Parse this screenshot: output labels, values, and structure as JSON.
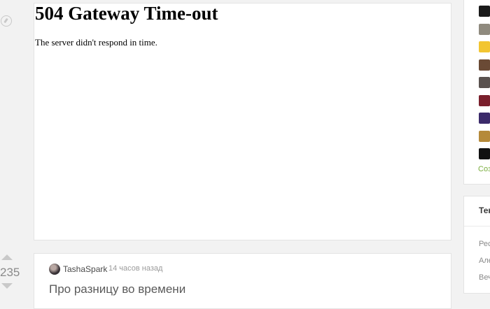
{
  "error_page": {
    "title": "504 Gateway Time-out",
    "message": "The server didn't respond in time."
  },
  "post": {
    "votes": "235",
    "author": "TashaSpark",
    "time": "14 часов назад",
    "title": "Про разницу во времени"
  },
  "sidebar": {
    "communities": [
      {
        "icon": "community-avatar-1",
        "color": "#1a1a1a"
      },
      {
        "icon": "community-avatar-2",
        "color": "#8f8a7e"
      },
      {
        "icon": "community-avatar-3",
        "color": "#f2c531"
      },
      {
        "icon": "community-avatar-4",
        "color": "#6a4a35"
      },
      {
        "icon": "community-avatar-5",
        "color": "#5a524f"
      },
      {
        "icon": "community-avatar-6",
        "color": "#7a1f2c"
      },
      {
        "icon": "community-avatar-7",
        "color": "#3b2a6a"
      },
      {
        "icon": "community-avatar-8",
        "color": "#b58a3a"
      },
      {
        "icon": "community-avatar-9",
        "color": "#111111"
      }
    ],
    "create_label": "Соз",
    "section_title": "Тек",
    "items": [
      "Рес",
      "Але",
      "Веч"
    ]
  },
  "colors": {
    "accent_green": "#7aae3e",
    "page_bg": "#f2f2f2"
  }
}
